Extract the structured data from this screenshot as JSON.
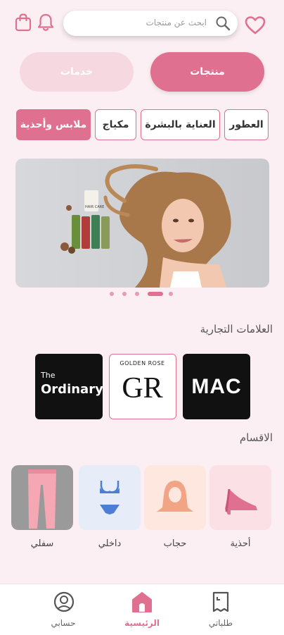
{
  "header": {
    "search_placeholder": "ابحث عن منتجات",
    "icons": [
      "heart-icon",
      "search-icon",
      "bell-icon",
      "shopping-bag-icon"
    ]
  },
  "segments": {
    "products": "منتجات",
    "services": "خدمات",
    "selected": "products"
  },
  "category_chips": [
    {
      "label": "العطور",
      "active": false
    },
    {
      "label": "العناية بالبشرة",
      "active": false
    },
    {
      "label": "مكياج",
      "active": false
    },
    {
      "label": "ملابس وأحذية",
      "active": true
    }
  ],
  "banner": {
    "product_text": "HAIR CARE",
    "dots_count": 5,
    "active_dot_index": 3
  },
  "brands": {
    "title": "العلامات التجارية",
    "items": [
      {
        "name": "MAC"
      },
      {
        "name": "GOLDEN ROSE",
        "monogram": "GR"
      },
      {
        "name": "The",
        "sub": "Ordinary."
      }
    ]
  },
  "categories": {
    "title": "الاقسام",
    "items": [
      {
        "label": "أحذية",
        "icon": "high-heel-icon"
      },
      {
        "label": "حجاب",
        "icon": "hijab-icon"
      },
      {
        "label": "داخلي",
        "icon": "lingerie-icon"
      },
      {
        "label": "سفلي",
        "icon": "pants-icon"
      }
    ]
  },
  "bottom_nav": [
    {
      "label": "طلباتي",
      "icon": "orders-icon",
      "active": false
    },
    {
      "label": "الرئيسية",
      "icon": "home-icon",
      "active": true
    },
    {
      "label": "حسابي",
      "icon": "account-icon",
      "active": false
    }
  ],
  "colors": {
    "primary": "#e0708f",
    "primary_light": "#f6d8e1",
    "background": "#fbeff3"
  }
}
